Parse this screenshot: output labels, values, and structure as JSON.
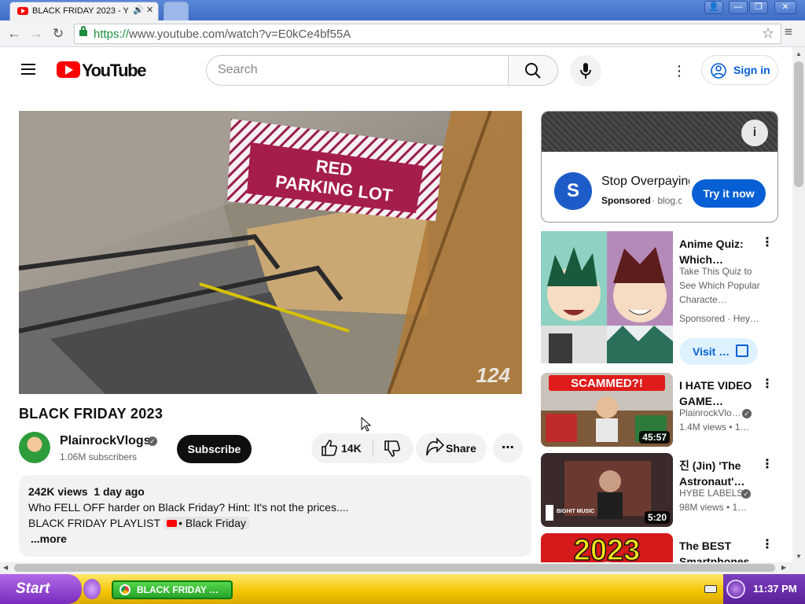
{
  "browser": {
    "tab_title": "BLACK FRIDAY 2023 - Yo",
    "url_scheme": "https://",
    "url_rest": "www.youtube.com/watch?v=E0kCe4bf55A",
    "window_buttons": [
      "👤",
      "—",
      "❐",
      "✕"
    ]
  },
  "header": {
    "logo_text": "YouTube",
    "search_placeholder": "Search",
    "signin_label": "Sign in"
  },
  "video": {
    "overlay_text_1": "RED",
    "overlay_text_2": "PARKING LOT",
    "watermark": "124",
    "title": "BLACK FRIDAY 2023",
    "channel": "PlainrockVlogs",
    "subscribers": "1.06M subscribers",
    "subscribe_label": "Subscribe",
    "likes": "14K",
    "share_label": "Share",
    "views": "242K views",
    "age": "1 day ago",
    "desc_line1": "Who FELL OFF harder on Black Friday? Hint: It's not the prices....",
    "desc_line2_prefix": "BLACK FRIDAY PLAYLIST",
    "playlist_link": "• Black Friday",
    "more_label": "...more"
  },
  "ad": {
    "logo_letter": "S",
    "title": "Stop Overpaying",
    "sponsored": "Sponsored",
    "domain": "· blog.c",
    "cta": "Try it now"
  },
  "recommendations": [
    {
      "title": "Anime Quiz: Which…",
      "line1": "Take This Quiz to See Which Popular Characte…",
      "line2": "Sponsored · Hey…",
      "cta": "Visit …"
    },
    {
      "title": "I HATE VIDEO GAME…",
      "channel": "PlainrockVlo…",
      "meta": "1.4M views • 1…",
      "duration": "45:57",
      "banner": "SCAMMED?!"
    },
    {
      "title": "진 (Jin) 'The Astronaut'…",
      "channel": "HYBE LABELS",
      "meta": "98M views • 1…",
      "duration": "5:20",
      "badge": "BIGHIT MUSIC"
    },
    {
      "title": "The BEST Smartphones…",
      "thumb_text": "2023"
    }
  ],
  "taskbar": {
    "start_label": "Start",
    "task_label": "BLACK FRIDAY …",
    "clock": "11:37 PM"
  },
  "colors": {
    "brand_red": "#ff0000",
    "link_blue": "#065fd4",
    "taskbar_yellow": "#f3c400"
  }
}
